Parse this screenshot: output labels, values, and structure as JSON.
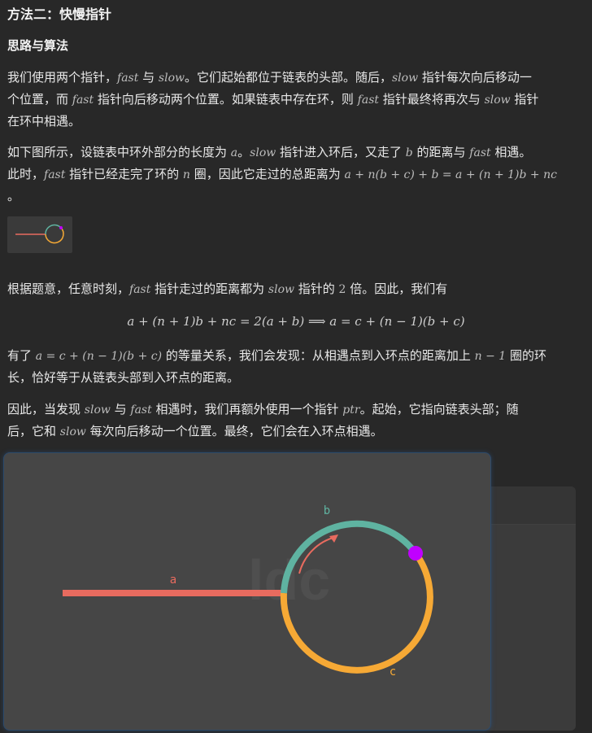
{
  "heading": "方法二：快慢指针",
  "subheading": "思路与算法",
  "p1": {
    "t1": "我们使用两个指针，",
    "fast": "fast",
    "t2": " 与 ",
    "slow": "slow",
    "t3": "。它们起始都位于链表的头部。随后，",
    "slow2": "slow",
    "t4": " 指针每次向后移动一",
    "t5": "个位置，而 ",
    "fast2": "fast",
    "t6": " 指针向后移动两个位置。如果链表中存在环，则 ",
    "fast3": "fast",
    "t7": " 指针最终将再次与 ",
    "slow3": "slow",
    "t8": " 指针",
    "t9": "在环中相遇。"
  },
  "p2": {
    "t1": "如下图所示，设链表中环外部分的长度为 ",
    "a": "a",
    "t2": "。",
    "slow": "slow",
    "t3": " 指针进入环后，又走了 ",
    "b": "b",
    "t4": " 的距离与 ",
    "fast": "fast",
    "t5": " 相遇。",
    "t6": "此时，",
    "fast2": "fast",
    "t7": " 指针已经走完了环的 ",
    "n": "n",
    "t8": " 圈，因此它走过的总距离为 ",
    "formula": "a + n(b + c) + b = a + (n + 1)b + nc",
    "t9": "。"
  },
  "p3": {
    "t1": "根据题意，任意时刻，",
    "fast": "fast",
    "t2": " 指针走过的距离都为 ",
    "slow": "slow",
    "t3": " 指针的 ",
    "two": "2",
    "t4": " 倍。因此，我们有"
  },
  "equation": "a + (n + 1)b + nc = 2(a + b)  ⟹  a = c + (n − 1)(b + c)",
  "p4": {
    "t1": "有了 ",
    "formula": "a = c + (n − 1)(b + c)",
    "t2": " 的等量关系，我们会发现：从相遇点到入环点的距离加上 ",
    "n1": "n − 1",
    "t3": " 圈的环",
    "t4": "长，恰好等于从链表头部到入环点的距离。"
  },
  "p5": {
    "t1": "因此，当发现 ",
    "slow": "slow",
    "t2": " 与 ",
    "fast": "fast",
    "t3": " 相遇时，我们再额外使用一个指针 ",
    "ptr": "ptr",
    "t4": "。起始，它指向链表头部；随",
    "t5": "后，它和 ",
    "slow2": "slow",
    "t6": " 每次向后移动一个位置。最终，它们会在入环点相遇。"
  },
  "figure": {
    "label_a": "a",
    "label_b": "b",
    "label_c": "c",
    "colors": {
      "segment_a": "#e86b5f",
      "arc_b": "#5fb3a1",
      "arc_c": "#f6a935",
      "meet_point": "#c000ff",
      "arrow": "#e86b5f"
    }
  }
}
